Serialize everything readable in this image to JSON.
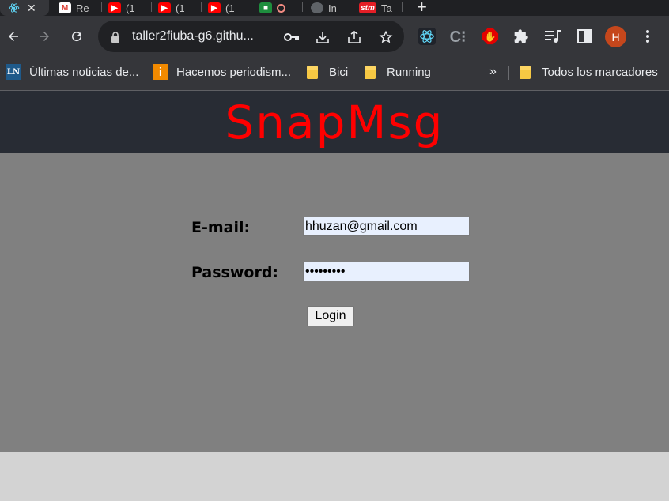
{
  "browser": {
    "tabs": [
      {
        "title": "",
        "favicon": "react-icon",
        "active": true
      },
      {
        "title": "Re",
        "favicon": "gmail-icon"
      },
      {
        "title": "(1",
        "favicon": "youtube-icon"
      },
      {
        "title": "(1",
        "favicon": "youtube-icon"
      },
      {
        "title": "(1",
        "favicon": "youtube-icon"
      },
      {
        "title": "",
        "favicon": "meet-icon"
      },
      {
        "title": "In",
        "favicon": "globe-icon"
      },
      {
        "title": "Ta",
        "favicon": "stm-icon"
      }
    ],
    "address": "taller2fiuba-g6.githu...",
    "avatar_letter": "H",
    "colors": {
      "avatar": "#c5471c",
      "chrome_dark": "#35363a"
    }
  },
  "bookmarks": {
    "items": [
      {
        "label": "Últimas noticias de...",
        "icon": "ln-icon"
      },
      {
        "label": "Hacemos periodism...",
        "icon": "info-icon"
      },
      {
        "label": "Bici",
        "icon": "folder-icon"
      },
      {
        "label": "Running",
        "icon": "folder-icon"
      }
    ],
    "overflow": "»",
    "all_bookmarks": "Todos los marcadores"
  },
  "app": {
    "brand": "SnapMsg",
    "brand_color": "#ff0000",
    "email_label": "E-mail:",
    "email_value": "hhuzan@gmail.com",
    "password_label": "Password:",
    "password_value": "passwordx",
    "login_label": "Login"
  }
}
